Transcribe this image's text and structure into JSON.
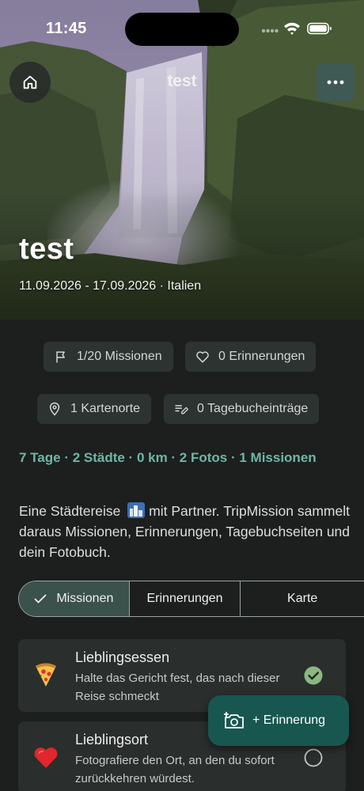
{
  "status_bar": {
    "time": "11:45"
  },
  "header": {
    "title": "test"
  },
  "trip": {
    "title": "test",
    "subtitle": "11.09.2026 - 17.09.2026 · Italien"
  },
  "chips": {
    "missions": "1/20 Missionen",
    "memories": "0 Erinnerungen",
    "map_places": "1 Kartenorte",
    "journal": "0 Tagebucheinträge"
  },
  "summary": {
    "stats": "7 Tage · 2 Städte · 0 km · 2 Fotos · 1 Missionen",
    "description_before": "Eine Städtereise",
    "description_after": " mit Partner. TripMission sammelt daraus Missionen, Erinnerungen, Tagebuchseiten und dein Fotobuch."
  },
  "tabs": [
    {
      "label": "Missionen",
      "selected": true
    },
    {
      "label": "Erinnerungen",
      "selected": false
    },
    {
      "label": "Karte",
      "selected": false
    }
  ],
  "missions": [
    {
      "title": "Lieblingsessen",
      "description": "Halte das Gericht fest, das nach dieser Reise schmeckt",
      "icon": "pizza-icon",
      "completed": true
    },
    {
      "title": "Lieblingsort",
      "description": "Fotografiere den Ort, an den du sofort zurückkehren würdest.",
      "icon": "heart-icon",
      "completed": false
    }
  ],
  "fab": {
    "label": "+ Erinnerung",
    "icon": "add-photo-icon"
  },
  "colors": {
    "background": "#1c1f1e",
    "accent": "#6fb6a8",
    "chip": "#2d3331",
    "active_tab": "#3a514c",
    "fab": "#17574f",
    "check": "#8ab87e"
  }
}
